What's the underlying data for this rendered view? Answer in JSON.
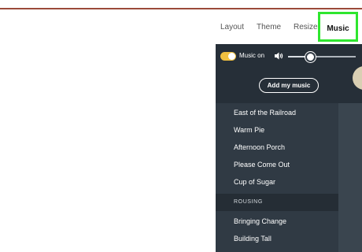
{
  "tabs": {
    "layout": "Layout",
    "theme": "Theme",
    "resize": "Resize",
    "music": "Music"
  },
  "music_panel": {
    "music_toggle_label": "Music on",
    "music_on": true,
    "volume_level": 0.33,
    "add_music_label": "Add my music",
    "tracks_top": [
      "East of the Railroad",
      "Warm Pie",
      "Afternoon Porch",
      "Please Come Out",
      "Cup of Sugar"
    ],
    "section_label": "ROUSING",
    "tracks_rousing": [
      "Bringing Change",
      "Building Tall"
    ]
  },
  "colors": {
    "accent_toggle": "#f0c040",
    "active_tab_border": "#2ee62e",
    "panel_bg": "#303a44"
  },
  "icons": [
    "speaker-icon"
  ]
}
